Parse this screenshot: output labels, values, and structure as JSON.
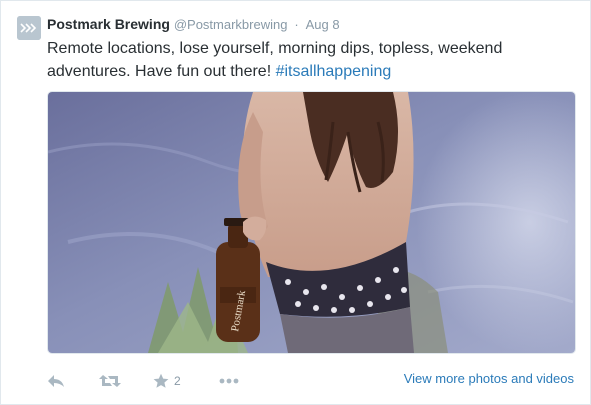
{
  "tweet": {
    "fullname": "Postmark Brewing",
    "username": "@Postmarkbrewing",
    "separator": "·",
    "timestamp": "Aug 8",
    "text": "Remote locations, lose yourself, morning dips, topless, weekend adventures. Have fun out there! ",
    "hashtag": "#itsallhappening",
    "bottle_label": "Postmark"
  },
  "actions": {
    "reply_icon": "reply-icon",
    "retweet_icon": "retweet-icon",
    "favorite_icon": "star-icon",
    "favorite_count": "2",
    "more_icon": "more-dots-icon",
    "view_more_label": "View more photos and videos"
  },
  "colors": {
    "name": "#292f33",
    "muted": "#8899a6",
    "link": "#2b7bb9",
    "icon": "#aab8c2"
  }
}
